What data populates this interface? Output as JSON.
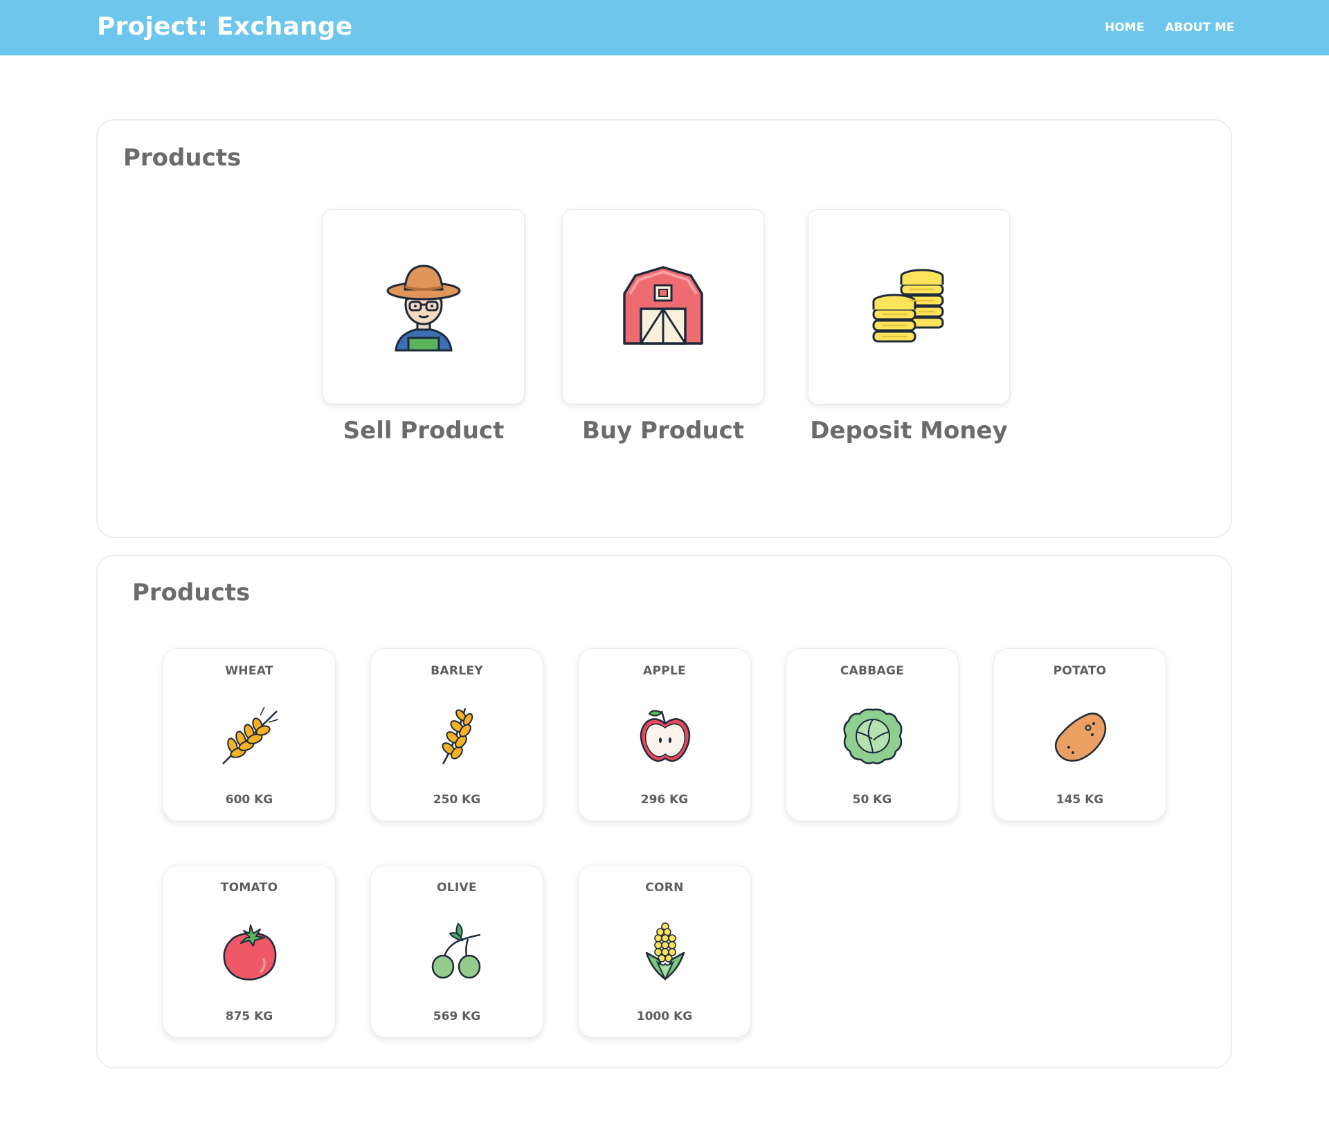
{
  "header": {
    "brand": "Project: Exchange",
    "nav": {
      "home": "HOME",
      "about": "ABOUT ME"
    },
    "background": "#6ec6ec"
  },
  "actions_panel": {
    "title": "Products",
    "actions": [
      {
        "label": "Sell Product",
        "icon": "farmer-icon"
      },
      {
        "label": "Buy Product",
        "icon": "barn-icon"
      },
      {
        "label": "Deposit Money",
        "icon": "coins-icon"
      }
    ]
  },
  "products_panel": {
    "title": "Products",
    "items": [
      {
        "name": "WHEAT",
        "qty": "600 KG",
        "icon": "wheat-icon"
      },
      {
        "name": "BARLEY",
        "qty": "250 KG",
        "icon": "barley-icon"
      },
      {
        "name": "APPLE",
        "qty": "296 KG",
        "icon": "apple-icon"
      },
      {
        "name": "CABBAGE",
        "qty": "50 KG",
        "icon": "cabbage-icon"
      },
      {
        "name": "POTATO",
        "qty": "145 KG",
        "icon": "potato-icon"
      },
      {
        "name": "TOMATO",
        "qty": "875 KG",
        "icon": "tomato-icon"
      },
      {
        "name": "OLIVE",
        "qty": "569 KG",
        "icon": "olive-icon"
      },
      {
        "name": "CORN",
        "qty": "1000 KG",
        "icon": "corn-icon"
      }
    ]
  }
}
